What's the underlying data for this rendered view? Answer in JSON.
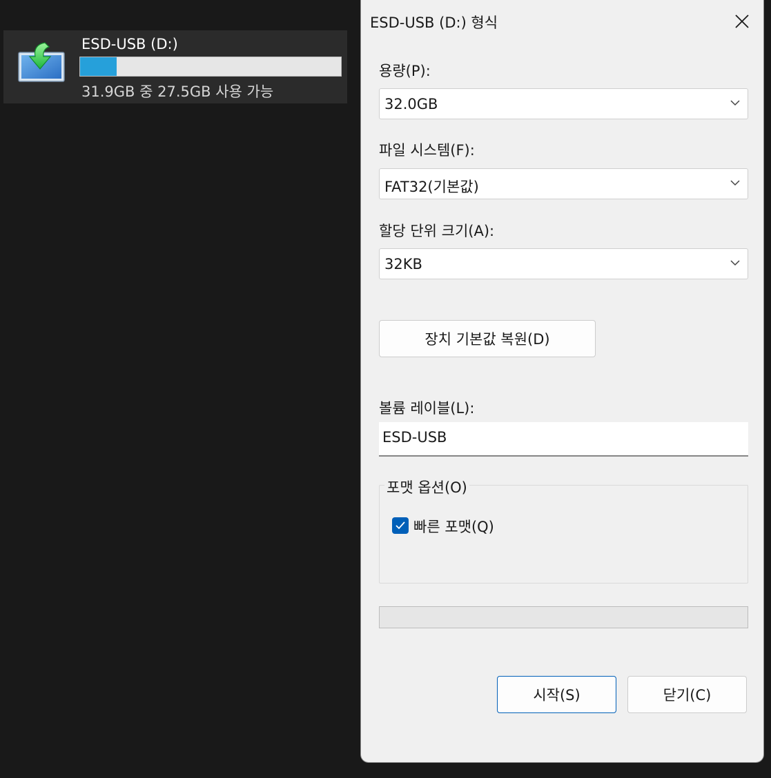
{
  "drive_tile": {
    "name": "ESD-USB (D:)",
    "space_text": "31.9GB 중 27.5GB 사용 가능",
    "used_fraction": 0.14,
    "icon": "usb-drive-icon",
    "bar_color": "#26a0da"
  },
  "dialog": {
    "title": "ESD-USB (D:) 형식",
    "capacity": {
      "label": "용량(P):",
      "value": "32.0GB"
    },
    "file_system": {
      "label": "파일 시스템(F):",
      "value": "FAT32(기본값)"
    },
    "allocation_unit": {
      "label": "할당 단위 크기(A):",
      "value": "32KB"
    },
    "restore_defaults_label": "장치 기본값 복원(D)",
    "volume_label": {
      "label": "볼륨 레이블(L):",
      "value": "ESD-USB"
    },
    "format_options": {
      "title": "포맷 옵션(O)",
      "quick_format_label": "빠른 포맷(Q)",
      "quick_format_checked": true
    },
    "progress_fraction": 0,
    "start_label": "시작(S)",
    "close_label": "닫기(C)",
    "accent_color": "#005fb8"
  }
}
